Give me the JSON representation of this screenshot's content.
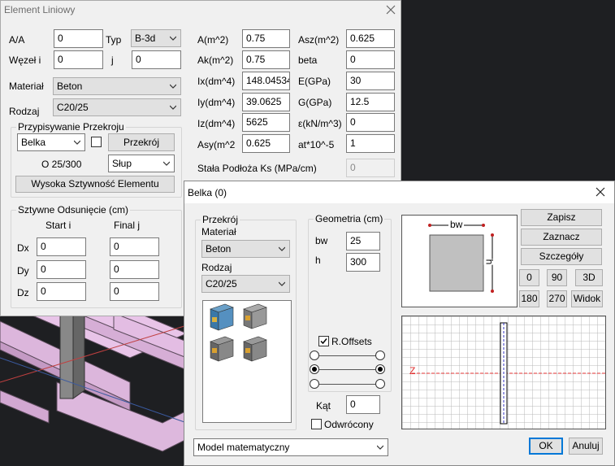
{
  "element_window": {
    "title": "Element Liniowy",
    "labels": {
      "aa": "A/A",
      "typ": "Typ",
      "wezel": "Węzeł i",
      "j": "j",
      "material": "Materiał",
      "rodzaj": "Rodzaj",
      "a": "A(m^2)",
      "asz": "Asz(m^2)",
      "ak": "Ak(m^2)",
      "beta": "beta",
      "ix": "Ix(dm^4)",
      "e": "E(GPa)",
      "iy": "Iy(dm^4)",
      "g": "G(GPa)",
      "iz": "Iz(dm^4)",
      "eps": "ε(kN/m^3)",
      "asy": "Asy(m^2)",
      "at": "at*10^-5",
      "ks": "Stała Podłoża Ks (MPa/cm)"
    },
    "values": {
      "aa": "0",
      "typ": "B-3d",
      "wezel": "0",
      "j": "0",
      "material": "Beton",
      "rodzaj": "C20/25",
      "a": "0.75",
      "asz": "0.625",
      "ak": "0.75",
      "beta": "0",
      "ix": "148.04534",
      "e": "30",
      "iy": "39.0625",
      "g": "12.5",
      "iz": "5625",
      "eps": "0",
      "asy": "0.625",
      "at": "1",
      "ks": "0"
    },
    "section_group": {
      "title": "Przypisywanie Przekroju",
      "type_select": "Belka",
      "przekroj_button": "Przekrój",
      "size_label": "O 25/300",
      "kind_select": "Słup",
      "stiffness_button": "Wysoka Sztywność Elementu"
    },
    "offsets_group": {
      "title": "Sztywne Odsunięcie (cm)",
      "col_start": "Start i",
      "col_final": "Final j",
      "rows": [
        {
          "label": "Dx",
          "start": "0",
          "final": "0"
        },
        {
          "label": "Dy",
          "start": "0",
          "final": "0"
        },
        {
          "label": "Dz",
          "start": "0",
          "final": "0"
        }
      ]
    }
  },
  "belka_window": {
    "title": "Belka (0)",
    "przekroj_group": {
      "title": "Przekrój",
      "material_label": "Materiał",
      "material_value": "Beton",
      "rodzaj_label": "Rodzaj",
      "rodzaj_value": "C20/25"
    },
    "geometry_group": {
      "title": "Geometria (cm)",
      "bw_label": "bw",
      "bw_value": "25",
      "h_label": "h",
      "h_value": "300",
      "roffsets_label": "R.Offsets"
    },
    "kat_label": "Kąt",
    "kat_value": "0",
    "odwrocony_label": "Odwrócony",
    "model_select": "Model matematyczny",
    "diagram_labels": {
      "bw": "bw",
      "h": "h",
      "z": "Z"
    },
    "buttons": {
      "zapisz": "Zapisz",
      "zaznacz": "Zaznacz",
      "szczegoly": "Szczegóły",
      "rot0": "0",
      "rot90": "90",
      "view3d": "3D",
      "rot180": "180",
      "rot270": "270",
      "widok": "Widok",
      "ok": "OK",
      "anuluj": "Anuluj"
    }
  },
  "colors": {
    "dark_bg": "#1e1f22",
    "pink_beam": "#e3bde3",
    "grid_red": "#e03030",
    "focus_blue": "#0078d7"
  }
}
